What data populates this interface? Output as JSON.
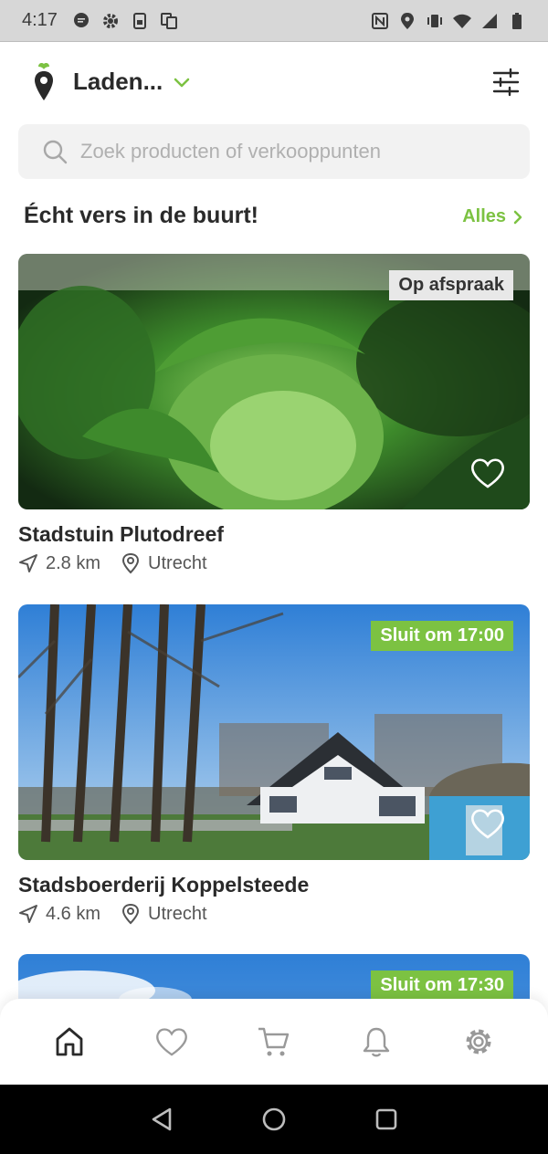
{
  "status_bar": {
    "time": "4:17",
    "left_icons": [
      "message-icon",
      "gear-icon",
      "sim-icon",
      "copy-icon"
    ],
    "right_icons": [
      "nfc-icon",
      "location-icon",
      "vibrate-icon",
      "wifi-icon",
      "signal-icon",
      "battery-icon"
    ]
  },
  "header": {
    "location_label": "Laden...",
    "accent_color": "#7cc242"
  },
  "search": {
    "placeholder": "Zoek producten of verkooppunten"
  },
  "section": {
    "title": "Écht vers in de buurt!",
    "all_label": "Alles"
  },
  "cards": [
    {
      "title": "Stadstuin Plutodreef",
      "distance": "2.8 km",
      "city": "Utrecht",
      "badge": "Op afspraak"
    },
    {
      "title": "Stadsboerderij Koppelsteede",
      "distance": "4.6 km",
      "city": "Utrecht",
      "badge": "Sluit om 17:00"
    },
    {
      "badge": "Sluit om 17:30"
    }
  ],
  "bottom_nav": {
    "items": [
      "home-icon",
      "heart-icon",
      "cart-icon",
      "bell-icon",
      "settings-icon"
    ]
  }
}
